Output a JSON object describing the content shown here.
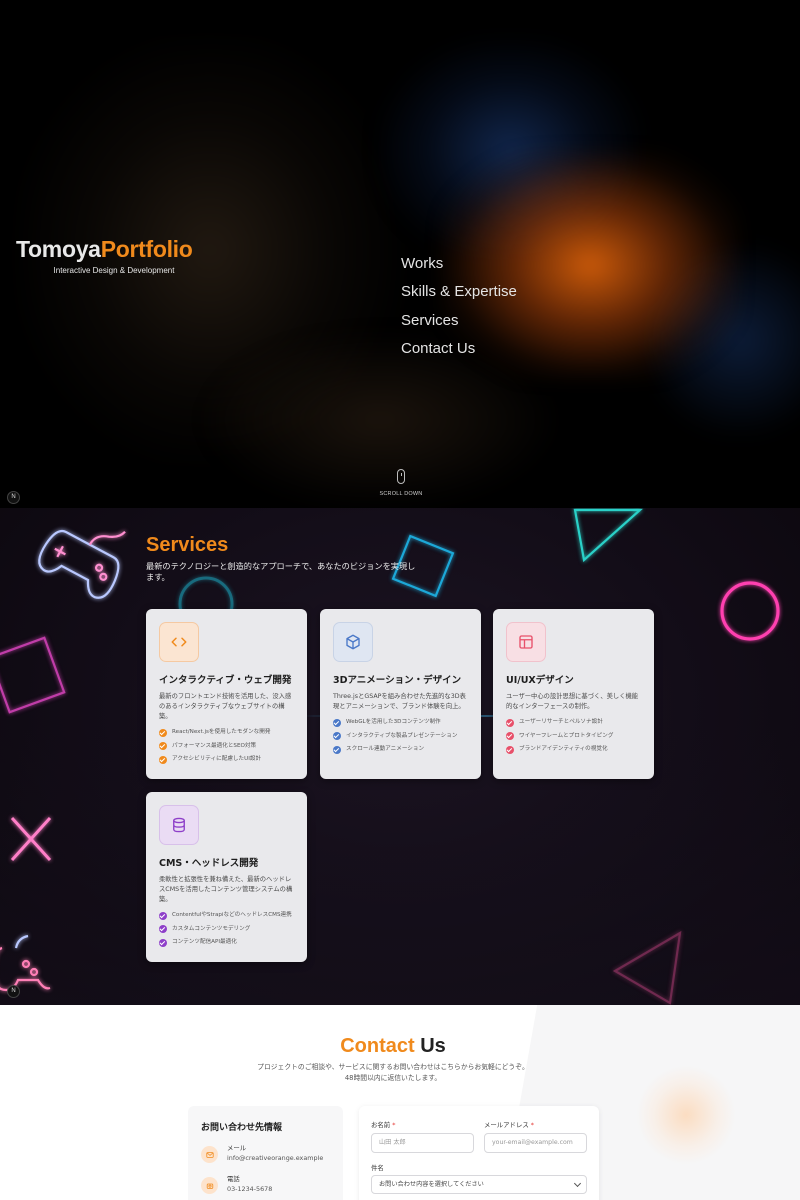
{
  "hero": {
    "brand_main": "Tomoya",
    "brand_accent": "Portfolio",
    "tagline": "Interactive Design & Development",
    "nav": [
      "Works",
      "Skills & Expertise",
      "Services",
      "Contact Us"
    ],
    "scroll_label": "SCROLL DOWN",
    "badge": "N"
  },
  "services": {
    "title": "Services",
    "description": "最新のテクノロジーと創造的なアプローチで、あなたのビジョンを実現します。",
    "badge": "N",
    "cards": [
      {
        "icon": "code-icon",
        "accent": "#f08a1c",
        "title": "インタラクティブ・ウェブ開発",
        "description": "最新のフロントエンド技術を活用した、没入感のあるインタラクティブなウェブサイトの構築。",
        "features": [
          "React/Next.jsを使用したモダンな開発",
          "パフォーマンス最適化とSEO対策",
          "アクセシビリティに配慮したUI設計"
        ]
      },
      {
        "icon": "cube-icon",
        "accent": "#4a78c8",
        "title": "3Dアニメーション・デザイン",
        "description": "Three.jsとGSAPを組み合わせた先進的な3D表現とアニメーションで、ブランド体験を向上。",
        "features": [
          "WebGLを活用した3Dコンテンツ制作",
          "インタラクティブな製品プレゼンテーション",
          "スクロール連動アニメーション"
        ]
      },
      {
        "icon": "layout-icon",
        "accent": "#e8506a",
        "title": "UI/UXデザイン",
        "description": "ユーザー中心の設計思想に基づく、美しく機能的なインターフェースの制作。",
        "features": [
          "ユーザーリサーチとペルソナ設計",
          "ワイヤーフレームとプロトタイピング",
          "ブランドアイデンティティの視覚化"
        ]
      },
      {
        "icon": "database-icon",
        "accent": "#8e3fc9",
        "title": "CMS・ヘッドレス開発",
        "description": "柔軟性と拡張性を兼ね備えた、最新のヘッドレスCMSを活用したコンテンツ管理システムの構築。",
        "features": [
          "ContentfulやStrapiなどのヘッドレスCMS連携",
          "カスタムコンテンツモデリング",
          "コンテンツ配信API最適化"
        ]
      }
    ]
  },
  "contact": {
    "title_accent": "Contact",
    "title_main": " Us",
    "description": "プロジェクトのご相談や、サービスに関するお問い合わせはこちらからお気軽にどうぞ。48時間以内に返信いたします。",
    "info": {
      "heading": "お問い合わせ先情報",
      "items": [
        {
          "label": "メール",
          "value": "info@creativeorange.example"
        },
        {
          "label": "電話",
          "value": "03-1234-5678"
        }
      ]
    },
    "form": {
      "name_label": "お名前",
      "name_placeholder": "山田 太郎",
      "email_label": "メールアドレス",
      "email_placeholder": "your-email@example.com",
      "subject_label": "件名",
      "subject_value": "お問い合わせ内容を選択してください",
      "required_mark": "*"
    }
  }
}
